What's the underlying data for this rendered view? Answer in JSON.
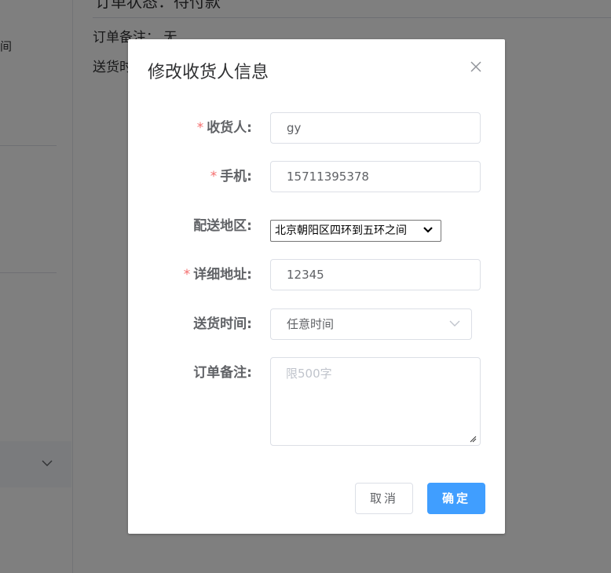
{
  "background": {
    "sidebar_text": "间",
    "main_title": "订单状态：待付款",
    "remark_row": "订单备注：  无",
    "delivery_row": "送货时"
  },
  "dialog": {
    "title": "修改收货人信息",
    "fields": {
      "receiver": {
        "label": "收货人:",
        "required": true,
        "value": "gy"
      },
      "phone": {
        "label": "手机:",
        "required": true,
        "value": "15711395378"
      },
      "region": {
        "label": "配送地区:",
        "required": false,
        "value": "北京朝阳区四环到五环之间"
      },
      "address": {
        "label": "详细地址:",
        "required": true,
        "value": "12345"
      },
      "delivery_time": {
        "label": "送货时间:",
        "required": false,
        "value": "任意时间"
      },
      "remark": {
        "label": "订单备注:",
        "required": false,
        "placeholder": "限500字"
      }
    },
    "required_mark": "*",
    "buttons": {
      "cancel": "取消",
      "confirm": "确定"
    }
  },
  "colors": {
    "primary": "#409eff",
    "required": "#f56c6c",
    "overlay": "rgba(0,0,0,0.5)"
  }
}
